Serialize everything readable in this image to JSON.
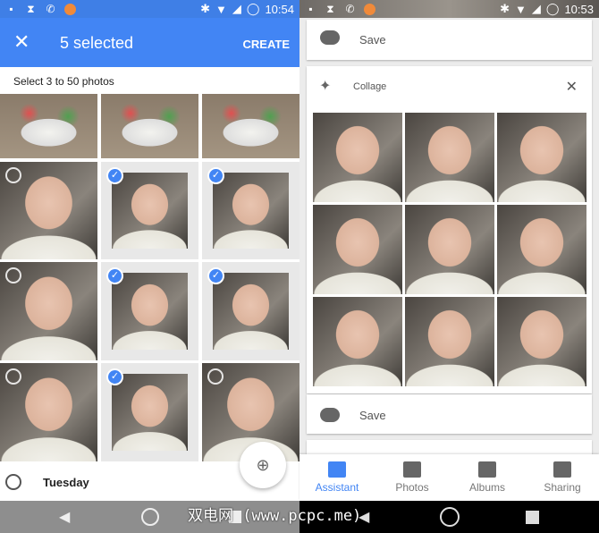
{
  "left": {
    "status": {
      "time": "10:54"
    },
    "appbar": {
      "title": "5 selected",
      "action": "CREATE"
    },
    "hint": "Select 3 to 50 photos",
    "grid": [
      {
        "type": "toy",
        "selected": false,
        "partial": true
      },
      {
        "type": "toy",
        "selected": false,
        "partial": true
      },
      {
        "type": "toy",
        "selected": false,
        "partial": true
      },
      {
        "type": "face",
        "selected": false
      },
      {
        "type": "face",
        "selected": true
      },
      {
        "type": "face",
        "selected": true
      },
      {
        "type": "face",
        "selected": false
      },
      {
        "type": "face",
        "selected": true
      },
      {
        "type": "face",
        "selected": true
      },
      {
        "type": "face",
        "selected": false
      },
      {
        "type": "face",
        "selected": true
      },
      {
        "type": "face",
        "selected": false
      }
    ],
    "date_label": "Tuesday"
  },
  "right": {
    "status": {
      "time": "10:53"
    },
    "save_top": "Save",
    "collage": {
      "title": "Collage",
      "cells": 9
    },
    "save_bottom": "Save",
    "tabs": [
      {
        "label": "Assistant",
        "active": true
      },
      {
        "label": "Photos"
      },
      {
        "label": "Albums"
      },
      {
        "label": "Sharing"
      }
    ]
  },
  "colors": {
    "accent": "#4285f4"
  },
  "watermark": "双电网 (www.pcpc.me)"
}
